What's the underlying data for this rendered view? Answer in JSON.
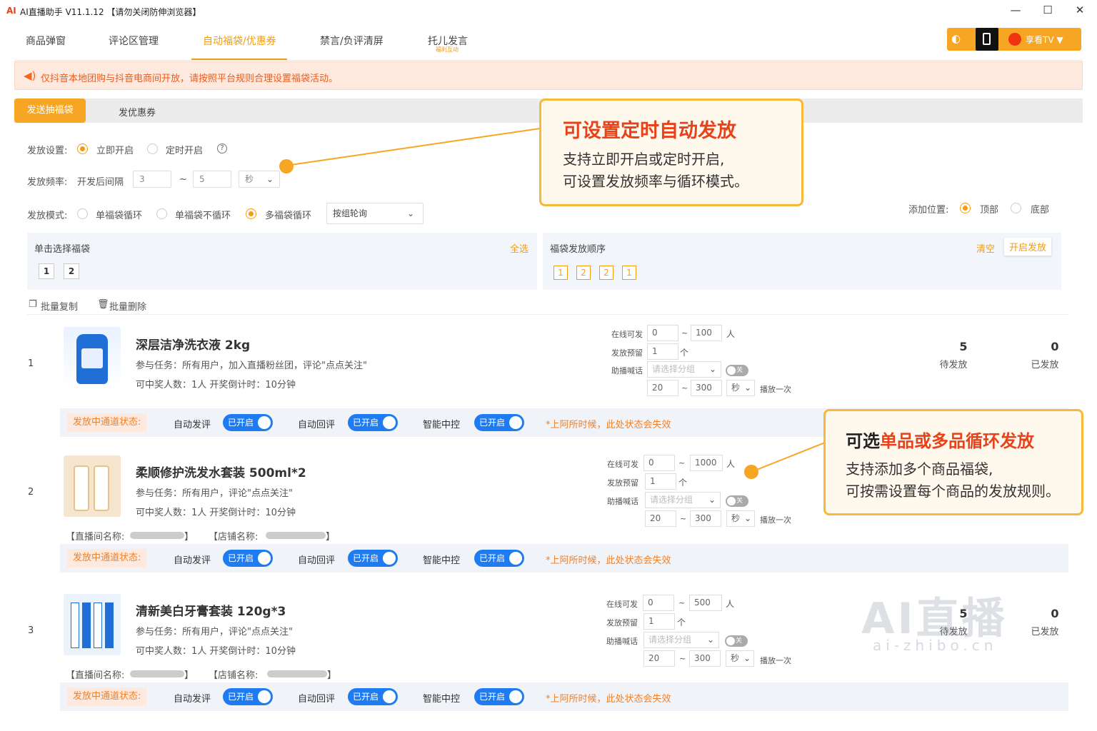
{
  "window": {
    "title": "AI直播助手 V11.1.12 【请勿关闭防伸浏览器】",
    "minimize": "—",
    "maximize": "☐",
    "close": "✕"
  },
  "nav": {
    "tabs": [
      "商品弹窗",
      "评论区管理",
      "自动福袋/优惠券",
      "禁言/负评清屏",
      "托儿发言"
    ],
    "tab4_sub": "福利互动"
  },
  "topright": {
    "account": "享看TV ▼"
  },
  "banner": {
    "text": "仅抖音本地团购与抖音电商间开放，请按照平台规则合理设置福袋活动。"
  },
  "subtabs": {
    "active": "发送抽福袋",
    "other": "发优惠券"
  },
  "settings": {
    "mode_label": "发放设置:",
    "immediate": "立即开启",
    "scheduled": "定时开启",
    "help": "?",
    "freq_label": "发放频率:",
    "freq_prefix": "开发后间隔",
    "freq_min": "3",
    "freq_sep": "~",
    "freq_max": "5",
    "freq_unit": "秒",
    "cycle_label": "发放模式:",
    "cycle_opts": [
      "单福袋循环",
      "单福袋不循环",
      "多福袋循环"
    ],
    "cycle_select": "按组轮询",
    "pos_label": "添加位置:",
    "pos_top": "顶部",
    "pos_bottom": "底部"
  },
  "select_panel": {
    "title": "单击选择福袋",
    "select_all": "全选",
    "items": [
      "1",
      "2"
    ]
  },
  "order_panel": {
    "title": "福袋发放顺序",
    "clear": "清空",
    "start": "开启发放",
    "items": [
      "1",
      "2",
      "2",
      "1"
    ]
  },
  "batch": {
    "copy": "批量复制",
    "delete": "批量删除"
  },
  "callout1": {
    "title": "可设置定时自动发放",
    "line1": "支持立即开启或定时开启,",
    "line2": "可设置发放频率与循环模式。"
  },
  "callout2": {
    "title_pre": "可选",
    "title_hl": "单品或多品循环发放",
    "line1": "支持添加多个商品福袋,",
    "line2": "可按需设置每个商品的发放规则。"
  },
  "products": [
    {
      "idx": "1",
      "title": "深层洁净洗衣液 2kg",
      "task": "参与任务：所有用户，加入直播粉丝团，评论\"点点关注\"",
      "award": "可中奖人数：1人 开奖倒计时：10分钟",
      "online_min": "0",
      "online_max": "100",
      "preset": "1",
      "pending": "5",
      "sent": "0"
    },
    {
      "idx": "2",
      "title": "柔顺修护洗发水套装 500ml*2",
      "task": "参与任务：所有用户，评论\"点点关注\"",
      "award": "可中奖人数：1人 开奖倒计时：10分钟",
      "online_min": "0",
      "online_max": "1000",
      "preset": "1",
      "pending": "",
      "sent": ""
    },
    {
      "idx": "3",
      "title": "清新美白牙膏套装 120g*3",
      "task": "参与任务：所有用户，评论\"点点关注\"",
      "award": "可中奖人数：1人 开奖倒计时：10分钟",
      "online_min": "0",
      "online_max": "500",
      "preset": "1",
      "pending": "5",
      "sent": "0"
    }
  ],
  "pcommon": {
    "online_label": "在线可发",
    "preset_label": "发放预留",
    "talk_label": "助播喊话",
    "sep": "~",
    "person": "人",
    "unit": "个",
    "talk_placeholder": "请选择分组",
    "toggle_off": "关",
    "int_min": "20",
    "int_max": "300",
    "sec": "秒",
    "play": "播放一次",
    "pending_lbl": "待发放",
    "sent_lbl": "已发放",
    "room_label": "【直播间名称:",
    "shop_label": "【店铺名称:",
    "bracket_close": "】"
  },
  "status": {
    "label": "发放中通道状态:",
    "auto_comment": "自动发评",
    "auto_reply": "自动回评",
    "smart": "智能中控",
    "on": "已开启",
    "warn": "*上阿所时候，此处状态会失效"
  },
  "watermark": {
    "big": "AI直播",
    "small": "ai-zhibo.cn"
  }
}
